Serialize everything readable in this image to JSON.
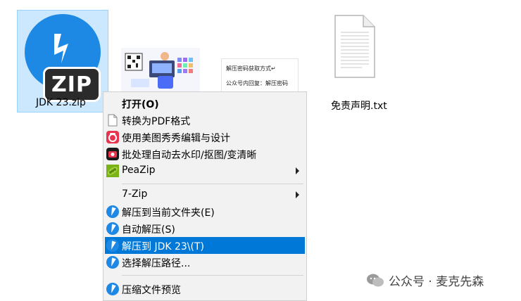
{
  "files": [
    {
      "name": "JDK 23.zip",
      "selected": true,
      "badge": "ZIP"
    },
    {
      "name": "",
      "type": "image-thumbnail"
    },
    {
      "name": "",
      "type": "doc-thumbnail",
      "lines": [
        "解压密码获取方式↵",
        "公众号内回复：解压密码"
      ]
    },
    {
      "name": "免责声明.txt",
      "type": "txt"
    }
  ],
  "context_menu": {
    "items": [
      {
        "label": "打开(O)",
        "bold": true,
        "icon": "none"
      },
      {
        "label": "转换为PDF格式",
        "icon": "document-icon"
      },
      {
        "label": "使用美图秀秀编辑与设计",
        "icon": "meitu-icon"
      },
      {
        "label": "批处理自动去水印/抠图/变清晰",
        "icon": "batch-icon"
      },
      {
        "label": "PeaZip",
        "icon": "peazip-icon",
        "submenu": true
      },
      {
        "label": "7-Zip",
        "icon": "none",
        "submenu": true
      },
      {
        "label": "解压到当前文件夹(E)",
        "icon": "bandizip-icon"
      },
      {
        "label": "自动解压(S)",
        "icon": "bandizip-icon"
      },
      {
        "label": "解压到 JDK 23\\(T)",
        "icon": "bandizip-icon",
        "highlighted": true
      },
      {
        "label": "选择解压路径...",
        "icon": "bandizip-icon"
      },
      {
        "label": "压缩文件预览",
        "icon": "bandizip-icon"
      }
    ]
  },
  "watermark": {
    "text": "公众号 · 麦克先森"
  },
  "colors": {
    "selection": "#cce8ff",
    "highlight": "#0078d7",
    "zip_blue": "#1e88e5"
  }
}
